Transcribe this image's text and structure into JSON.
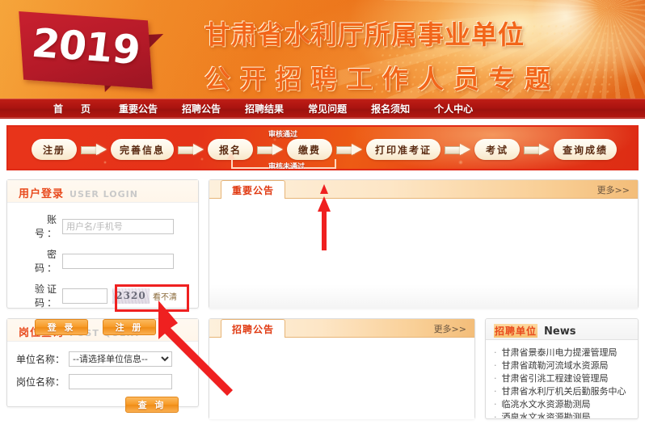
{
  "banner": {
    "year": "2019",
    "title_line1": "甘肃省水利厅所属事业单位",
    "title_line2": "公开招聘工作人员专题"
  },
  "nav": {
    "items": [
      {
        "label": "首　页"
      },
      {
        "label": "重要公告"
      },
      {
        "label": "招聘公告"
      },
      {
        "label": "招聘结果"
      },
      {
        "label": "常见问题"
      },
      {
        "label": "报名须知"
      },
      {
        "label": "个人中心"
      }
    ]
  },
  "steps": {
    "items": [
      {
        "label": "注册"
      },
      {
        "label": "完善信息"
      },
      {
        "label": "报名"
      },
      {
        "label": "缴费"
      },
      {
        "label": "打印准考证"
      },
      {
        "label": "考试"
      },
      {
        "label": "查询成绩"
      }
    ],
    "pass_label": "审核通过",
    "fail_label": "审核未通过"
  },
  "login": {
    "title_cn": "用户登录",
    "title_en": "USER LOGIN",
    "account_label": "账　号：",
    "account_placeholder": "用户名/手机号",
    "account_value": "",
    "password_label": "密　码：",
    "password_value": "",
    "captcha_label": "验证码：",
    "captcha_value": "",
    "captcha_code": "2320",
    "captcha_refresh": "看不清",
    "login_button": "登 录",
    "register_button": "注 册"
  },
  "query": {
    "title_cn": "岗位查询",
    "title_en": "POST QUERY",
    "unit_label": "单位名称：",
    "unit_selected": "--请选择单位信息--",
    "unit_options": [
      "--请选择单位信息--"
    ],
    "post_label": "岗位名称：",
    "post_value": "",
    "search_button": "查 询"
  },
  "important": {
    "tab_label": "重要公告",
    "more_label": "更多>>"
  },
  "recruit": {
    "tab_label": "招聘公告",
    "more_label": "更多>>"
  },
  "news": {
    "title_cn": "招聘单位",
    "title_en": "News",
    "items": [
      {
        "label": "甘肃省景泰川电力提灌管理局"
      },
      {
        "label": "甘肃省疏勒河流域水资源局"
      },
      {
        "label": "甘肃省引洮工程建设管理局"
      },
      {
        "label": "甘肃省水利厅机关后勤服务中心"
      },
      {
        "label": "临洮水文水资源勘测局"
      },
      {
        "label": "酒泉水文水资源勘测局"
      }
    ]
  },
  "colors": {
    "brand_red": "#e03a12",
    "brand_orange": "#f08a28",
    "nav_red": "#ab1410",
    "annotation_red": "#ef2020",
    "button_orange": "#f79b28"
  }
}
